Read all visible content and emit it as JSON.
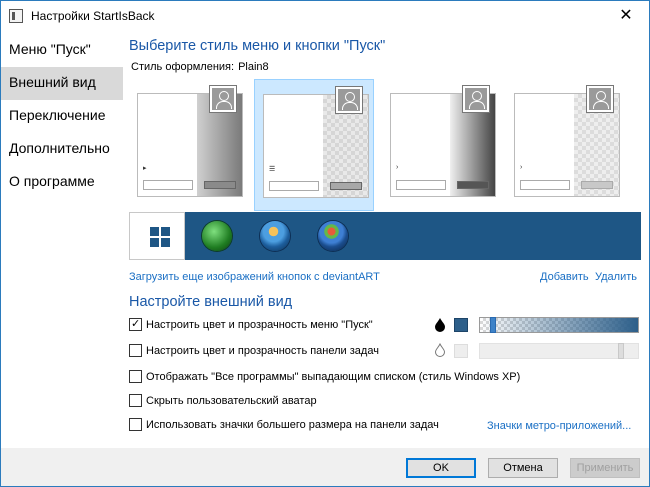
{
  "window": {
    "title": "Настройки StartIsBack",
    "close_glyph": "✕"
  },
  "sidebar": {
    "items": [
      {
        "label": "Меню \"Пуск\"",
        "active": false
      },
      {
        "label": "Внешний вид",
        "active": true
      },
      {
        "label": "Переключение",
        "active": false
      },
      {
        "label": "Дополнительно",
        "active": false
      },
      {
        "label": "О программе",
        "active": false
      }
    ]
  },
  "main": {
    "heading": "Выберите стиль меню и кнопки \"Пуск\"",
    "style_label": "Стиль оформления:",
    "style_value": "Plain8",
    "thumbnails": [
      {
        "name": "style-thumb-1",
        "selected": false
      },
      {
        "name": "style-thumb-2",
        "selected": true
      },
      {
        "name": "style-thumb-3",
        "selected": false
      },
      {
        "name": "style-thumb-4",
        "selected": false
      }
    ],
    "start_buttons": [
      {
        "icon": "windows-10-logo-icon",
        "selected": true
      },
      {
        "icon": "clover-orb-icon",
        "selected": false
      },
      {
        "icon": "windows-xp-orb-icon",
        "selected": false
      },
      {
        "icon": "windows-7-orb-icon",
        "selected": false
      }
    ],
    "download_link": "Загрузить еще изображений кнопок с deviantART",
    "add_link": "Добавить",
    "delete_link": "Удалить"
  },
  "appearance": {
    "heading": "Настройте внешний вид",
    "options": [
      {
        "label": "Настроить цвет и прозрачность меню \"Пуск\"",
        "checked": true
      },
      {
        "label": "Настроить цвет и прозрачность панели задач",
        "checked": false
      },
      {
        "label": "Отображать \"Все программы\" выпадающим списком (стиль Windows XP)",
        "checked": false
      },
      {
        "label": "Скрыть пользовательский аватар",
        "checked": false
      },
      {
        "label": "Использовать значки большего размера на панели задач",
        "checked": false
      }
    ],
    "menu_color": "#2d5f8a",
    "menu_transparency": 0.08,
    "taskbar_transparency": 0.9,
    "metro_link": "Значки метро-приложений..."
  },
  "footer": {
    "ok": "OK",
    "cancel": "Отмена",
    "apply": "Применить"
  }
}
